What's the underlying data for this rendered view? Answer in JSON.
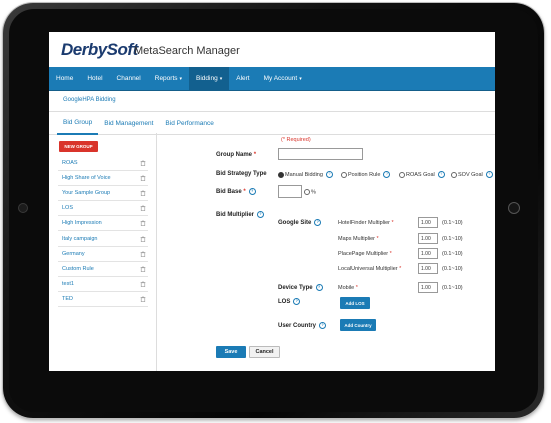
{
  "brand": {
    "logo": "DerbySoft",
    "app_title": "MetaSearch Manager"
  },
  "nav": {
    "items": [
      {
        "label": "Home",
        "caret": ""
      },
      {
        "label": "Hotel",
        "caret": ""
      },
      {
        "label": "Channel",
        "caret": ""
      },
      {
        "label": "Reports",
        "caret": "▾"
      },
      {
        "label": "Bidding",
        "caret": "▾"
      },
      {
        "label": "Alert",
        "caret": ""
      },
      {
        "label": "My Account",
        "caret": "▾"
      }
    ],
    "active_index": 4
  },
  "breadcrumb": "GoogleHPA Bidding",
  "tabs": [
    "Bid Group",
    "Bid Management",
    "Bid Performance"
  ],
  "sidebar": {
    "new_group_label": "NEW GROUP",
    "groups": [
      "ROAS",
      "High Share of Voice",
      "Your Sample Group",
      "LOS",
      "High Impression",
      "Italy campaign",
      "Germany",
      "Custom Rule",
      "test1",
      "TED"
    ]
  },
  "form": {
    "required_note": "(* Required)",
    "required_mark": "*",
    "group_name_label": "Group Name",
    "group_name_value": "",
    "bid_strategy_label": "Bid Strategy Type",
    "strategies": [
      {
        "label": "Manual Bidding",
        "checked": true
      },
      {
        "label": "Position Rule",
        "checked": false
      },
      {
        "label": "ROAS Goal",
        "checked": false
      },
      {
        "label": "SOV Goal",
        "checked": false
      }
    ],
    "bid_base_label": "Bid Base",
    "bid_base_value": "",
    "bid_base_unit": "%",
    "bid_multiplier_label": "Bid Multiplier",
    "google_site_label": "Google Site",
    "multipliers": [
      {
        "label": "HotelFinder Multiplier",
        "value": "1.00",
        "range": "(0.1~10)"
      },
      {
        "label": "Maps Multiplier",
        "value": "1.00",
        "range": "(0.1~10)"
      },
      {
        "label": "PlacePage Multiplier",
        "value": "1.00",
        "range": "(0.1~10)"
      },
      {
        "label": "LocalUniversal Multiplier",
        "value": "1.00",
        "range": "(0.1~10)"
      }
    ],
    "device_type_label": "Device Type",
    "mobile": {
      "label": "Mobile",
      "value": "1.00",
      "range": "(0.1~10)"
    },
    "los_label": "LOS",
    "add_los_label": "Add LOS",
    "user_country_label": "User Country",
    "add_country_label": "Add Country",
    "save_label": "Save",
    "cancel_label": "Cancel"
  },
  "colors": {
    "brand_blue": "#1b7bb5",
    "nav_active": "#12608f",
    "danger": "#d9342b"
  },
  "icons": {
    "help": "help-icon",
    "trash": "trash-icon"
  }
}
